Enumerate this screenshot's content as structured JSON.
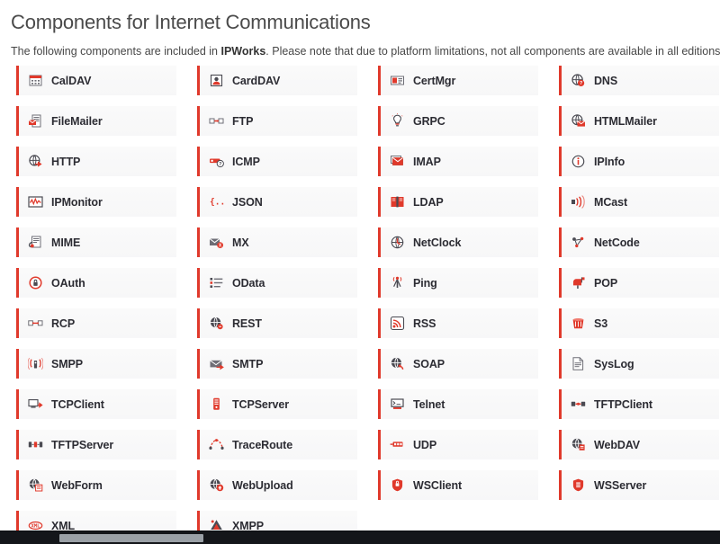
{
  "header": {
    "title": "Components for Internet Communications",
    "subtitle_prefix": "The following components are included in ",
    "subtitle_product": "IPWorks",
    "subtitle_suffix": ". Please note that due to platform limitations, not all components are available in all editions."
  },
  "theme": {
    "accent_red": "#e0392b",
    "card_background": "#fafafa",
    "label_color": "#2c2c33",
    "title_color": "#4a4a4a",
    "scrollbar_track": "#14161a",
    "scrollbar_thumb": "#9aa0a6"
  },
  "components": [
    {
      "label": "CalDAV",
      "icon": "calendar-icon"
    },
    {
      "label": "CardDAV",
      "icon": "contact-card-icon"
    },
    {
      "label": "CertMgr",
      "icon": "certificate-icon"
    },
    {
      "label": "DNS",
      "icon": "globe-question-icon"
    },
    {
      "label": "FileMailer",
      "icon": "file-mail-icon"
    },
    {
      "label": "FTP",
      "icon": "file-transfer-icon"
    },
    {
      "label": "GRPC",
      "icon": "grpc-bulb-icon"
    },
    {
      "label": "HTMLMailer",
      "icon": "globe-mail-icon"
    },
    {
      "label": "HTTP",
      "icon": "globe-arrow-icon"
    },
    {
      "label": "ICMP",
      "icon": "packet-question-icon"
    },
    {
      "label": "IMAP",
      "icon": "mail-stack-icon"
    },
    {
      "label": "IPInfo",
      "icon": "info-circle-icon"
    },
    {
      "label": "IPMonitor",
      "icon": "monitor-wave-icon"
    },
    {
      "label": "JSON",
      "icon": "braces-icon"
    },
    {
      "label": "LDAP",
      "icon": "book-icon"
    },
    {
      "label": "MCast",
      "icon": "multicast-icon"
    },
    {
      "label": "MIME",
      "icon": "mime-attach-icon"
    },
    {
      "label": "MX",
      "icon": "mail-exchange-icon"
    },
    {
      "label": "NetClock",
      "icon": "clock-globe-icon"
    },
    {
      "label": "NetCode",
      "icon": "netcode-icon"
    },
    {
      "label": "OAuth",
      "icon": "oauth-lock-icon"
    },
    {
      "label": "OData",
      "icon": "odata-list-icon"
    },
    {
      "label": "Ping",
      "icon": "antenna-icon"
    },
    {
      "label": "POP",
      "icon": "mailbox-flag-icon"
    },
    {
      "label": "RCP",
      "icon": "remote-copy-icon"
    },
    {
      "label": "REST",
      "icon": "rest-globe-icon"
    },
    {
      "label": "RSS",
      "icon": "rss-feed-icon"
    },
    {
      "label": "S3",
      "icon": "bucket-icon"
    },
    {
      "label": "SMPP",
      "icon": "signal-broadcast-icon"
    },
    {
      "label": "SMTP",
      "icon": "envelope-send-icon"
    },
    {
      "label": "SOAP",
      "icon": "soap-globe-icon"
    },
    {
      "label": "SysLog",
      "icon": "log-document-icon"
    },
    {
      "label": "TCPClient",
      "icon": "tcp-client-icon"
    },
    {
      "label": "TCPServer",
      "icon": "server-tower-icon"
    },
    {
      "label": "Telnet",
      "icon": "terminal-monitor-icon"
    },
    {
      "label": "TFTPClient",
      "icon": "tftp-client-icon"
    },
    {
      "label": "TFTPServer",
      "icon": "tftp-server-icon"
    },
    {
      "label": "TraceRoute",
      "icon": "traceroute-icon"
    },
    {
      "label": "UDP",
      "icon": "udp-packet-icon"
    },
    {
      "label": "WebDAV",
      "icon": "webdav-globe-icon"
    },
    {
      "label": "WebForm",
      "icon": "webform-globe-icon"
    },
    {
      "label": "WebUpload",
      "icon": "web-upload-icon"
    },
    {
      "label": "WSClient",
      "icon": "websocket-client-icon"
    },
    {
      "label": "WSServer",
      "icon": "websocket-server-icon"
    },
    {
      "label": "XML",
      "icon": "xml-tag-icon"
    },
    {
      "label": "XMPP",
      "icon": "xmpp-icon"
    }
  ]
}
